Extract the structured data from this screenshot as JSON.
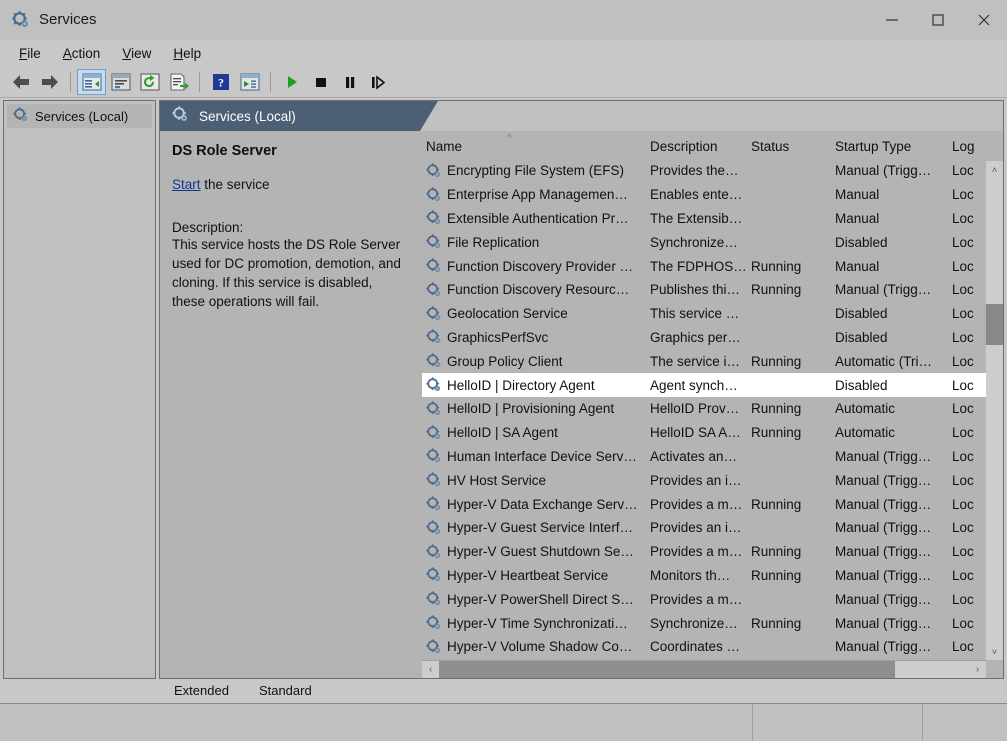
{
  "window": {
    "title": "Services",
    "icon": "services-gear-icon",
    "minimize_label": "Minimize",
    "maximize_label": "Maximize",
    "close_label": "Close"
  },
  "menu": [
    {
      "label": "File",
      "accel": "F"
    },
    {
      "label": "Action",
      "accel": "A"
    },
    {
      "label": "View",
      "accel": "V"
    },
    {
      "label": "Help",
      "accel": "H"
    }
  ],
  "toolbar": [
    {
      "name": "back-icon",
      "type": "arrow-left"
    },
    {
      "name": "forward-icon",
      "type": "arrow-right"
    },
    {
      "name": "separator",
      "type": "sep"
    },
    {
      "name": "show-hide-tree-icon",
      "type": "tree",
      "active": true
    },
    {
      "name": "properties-icon",
      "type": "properties"
    },
    {
      "name": "refresh-icon",
      "type": "refresh"
    },
    {
      "name": "export-list-icon",
      "type": "export"
    },
    {
      "name": "separator",
      "type": "sep"
    },
    {
      "name": "help-icon",
      "type": "help"
    },
    {
      "name": "console-window-icon",
      "type": "console"
    },
    {
      "name": "separator",
      "type": "sep"
    },
    {
      "name": "start-service-icon",
      "type": "play"
    },
    {
      "name": "stop-service-icon",
      "type": "stop"
    },
    {
      "name": "pause-service-icon",
      "type": "pause"
    },
    {
      "name": "restart-service-icon",
      "type": "restart"
    }
  ],
  "sidebar": {
    "items": [
      {
        "label": "Services (Local)",
        "icon": "services-gear-icon",
        "selected": true
      }
    ]
  },
  "pane": {
    "header_title": "Services (Local)",
    "header_icon": "services-gear-icon"
  },
  "details": {
    "service_name": "DS Role Server",
    "action_link": "Start",
    "action_suffix": " the service",
    "description_label": "Description:",
    "description_text": "This service hosts the DS Role Server used for DC promotion, demotion, and cloning. If this service is disabled, these operations will fail."
  },
  "list": {
    "sort_column": "Name",
    "sort_direction": "ascending",
    "columns": [
      {
        "key": "name",
        "label": "Name"
      },
      {
        "key": "desc",
        "label": "Description"
      },
      {
        "key": "status",
        "label": "Status"
      },
      {
        "key": "startup",
        "label": "Startup Type"
      },
      {
        "key": "logon",
        "label": "Log"
      }
    ],
    "rows": [
      {
        "name": "Encrypting File System (EFS)",
        "desc": "Provides the…",
        "status": "",
        "startup": "Manual (Trigg…",
        "logon": "Loc",
        "selected": false
      },
      {
        "name": "Enterprise App Managemen…",
        "desc": "Enables ente…",
        "status": "",
        "startup": "Manual",
        "logon": "Loc",
        "selected": false
      },
      {
        "name": "Extensible Authentication Pr…",
        "desc": "The Extensib…",
        "status": "",
        "startup": "Manual",
        "logon": "Loc",
        "selected": false
      },
      {
        "name": "File Replication",
        "desc": "Synchronize…",
        "status": "",
        "startup": "Disabled",
        "logon": "Loc",
        "selected": false
      },
      {
        "name": "Function Discovery Provider …",
        "desc": "The FDPHOS…",
        "status": "Running",
        "startup": "Manual",
        "logon": "Loc",
        "selected": false
      },
      {
        "name": "Function Discovery Resourc…",
        "desc": "Publishes thi…",
        "status": "Running",
        "startup": "Manual (Trigg…",
        "logon": "Loc",
        "selected": false
      },
      {
        "name": "Geolocation Service",
        "desc": "This service …",
        "status": "",
        "startup": "Disabled",
        "logon": "Loc",
        "selected": false
      },
      {
        "name": "GraphicsPerfSvc",
        "desc": "Graphics per…",
        "status": "",
        "startup": "Disabled",
        "logon": "Loc",
        "selected": false
      },
      {
        "name": "Group Policy Client",
        "desc": "The service i…",
        "status": "Running",
        "startup": "Automatic (Tri…",
        "logon": "Loc",
        "selected": false
      },
      {
        "name": "HelloID | Directory Agent",
        "desc": "Agent synch…",
        "status": "",
        "startup": "Disabled",
        "logon": "Loc",
        "selected": true
      },
      {
        "name": "HelloID | Provisioning Agent",
        "desc": "HelloID Prov…",
        "status": "Running",
        "startup": "Automatic",
        "logon": "Loc",
        "selected": false
      },
      {
        "name": "HelloID | SA Agent",
        "desc": "HelloID SA A…",
        "status": "Running",
        "startup": "Automatic",
        "logon": "Loc",
        "selected": false
      },
      {
        "name": "Human Interface Device Serv…",
        "desc": "Activates an…",
        "status": "",
        "startup": "Manual (Trigg…",
        "logon": "Loc",
        "selected": false
      },
      {
        "name": "HV Host Service",
        "desc": "Provides an i…",
        "status": "",
        "startup": "Manual (Trigg…",
        "logon": "Loc",
        "selected": false
      },
      {
        "name": "Hyper-V Data Exchange Serv…",
        "desc": "Provides a m…",
        "status": "Running",
        "startup": "Manual (Trigg…",
        "logon": "Loc",
        "selected": false
      },
      {
        "name": "Hyper-V Guest Service Interf…",
        "desc": "Provides an i…",
        "status": "",
        "startup": "Manual (Trigg…",
        "logon": "Loc",
        "selected": false
      },
      {
        "name": "Hyper-V Guest Shutdown Se…",
        "desc": "Provides a m…",
        "status": "Running",
        "startup": "Manual (Trigg…",
        "logon": "Loc",
        "selected": false
      },
      {
        "name": "Hyper-V Heartbeat Service",
        "desc": "Monitors th…",
        "status": "Running",
        "startup": "Manual (Trigg…",
        "logon": "Loc",
        "selected": false
      },
      {
        "name": "Hyper-V PowerShell Direct S…",
        "desc": "Provides a m…",
        "status": "",
        "startup": "Manual (Trigg…",
        "logon": "Loc",
        "selected": false
      },
      {
        "name": "Hyper-V Time Synchronizati…",
        "desc": "Synchronize…",
        "status": "Running",
        "startup": "Manual (Trigg…",
        "logon": "Loc",
        "selected": false
      },
      {
        "name": "Hyper-V Volume Shadow Co…",
        "desc": "Coordinates …",
        "status": "",
        "startup": "Manual (Trigg…",
        "logon": "Loc",
        "selected": false
      }
    ]
  },
  "tabs": [
    {
      "label": "Extended",
      "active": false
    },
    {
      "label": "Standard",
      "active": true
    }
  ],
  "scrollbars": {
    "vertical_up": "˄",
    "vertical_down": "˅",
    "horizontal_left": "‹",
    "horizontal_right": "›"
  },
  "colors": {
    "pane_header": "#4d5f75",
    "link": "#12389c",
    "selection": "#ffffff",
    "window_chrome": "#c8c8c8",
    "play_green": "#1f9e28"
  }
}
